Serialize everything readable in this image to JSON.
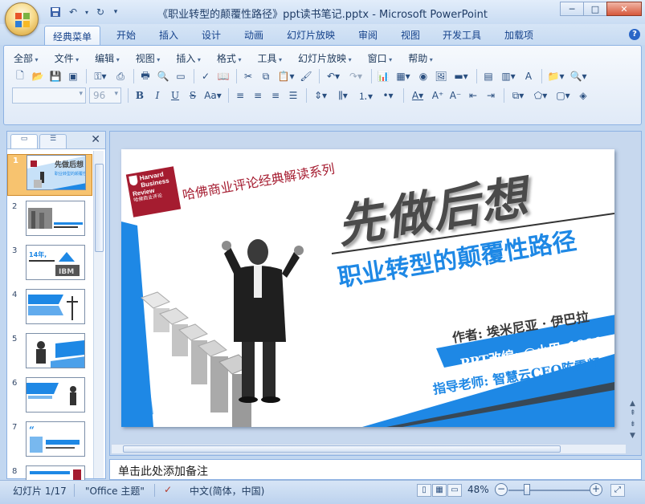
{
  "window": {
    "title": "《职业转型的颠覆性路径》ppt读书笔记.pptx - Microsoft PowerPoint",
    "minimize": "─",
    "maximize": "□",
    "close": "✕"
  },
  "qat": {
    "save_icon": "save-icon",
    "undo_icon": "undo-icon",
    "redo_icon": "redo-icon"
  },
  "tabs": [
    {
      "label": "经典菜单",
      "active": true
    },
    {
      "label": "开始"
    },
    {
      "label": "插入"
    },
    {
      "label": "设计"
    },
    {
      "label": "动画"
    },
    {
      "label": "幻灯片放映"
    },
    {
      "label": "审阅"
    },
    {
      "label": "视图"
    },
    {
      "label": "开发工具"
    },
    {
      "label": "加载项"
    }
  ],
  "menus": [
    "全部",
    "文件",
    "编辑",
    "视图",
    "插入",
    "格式",
    "工具",
    "幻灯片放映",
    "窗口",
    "帮助"
  ],
  "toolbar": {
    "font_size": "96"
  },
  "slides_panel": {
    "slide_numbers": [
      "1",
      "2",
      "3",
      "4",
      "5",
      "6",
      "7",
      "8"
    ],
    "selected": 1
  },
  "slide": {
    "logo_line1": "Harvard",
    "logo_line2": "Business",
    "logo_line3": "Review",
    "logo_cn": "哈佛商业评论",
    "series": "哈佛商业评论经典解读系列",
    "main_title": "先做后想",
    "subtitle": "职业转型的颠覆性路径",
    "author": "作者: 埃米尼亚 · 伊巴拉",
    "ppt_adapt": "PPT改编: @小巴_1990",
    "instructor": "指导老师: 智慧云CEO陈雪频"
  },
  "notes": {
    "placeholder": "单击此处添加备注"
  },
  "status": {
    "slide_info": "幻灯片 1/17",
    "theme": "\"Office 主题\"",
    "language": "中文(简体，中国)",
    "zoom": "48%"
  },
  "colors": {
    "accent_blue": "#1e88e5",
    "hbr_red": "#a51c30",
    "ribbon_bg": "#dbe7f5"
  }
}
